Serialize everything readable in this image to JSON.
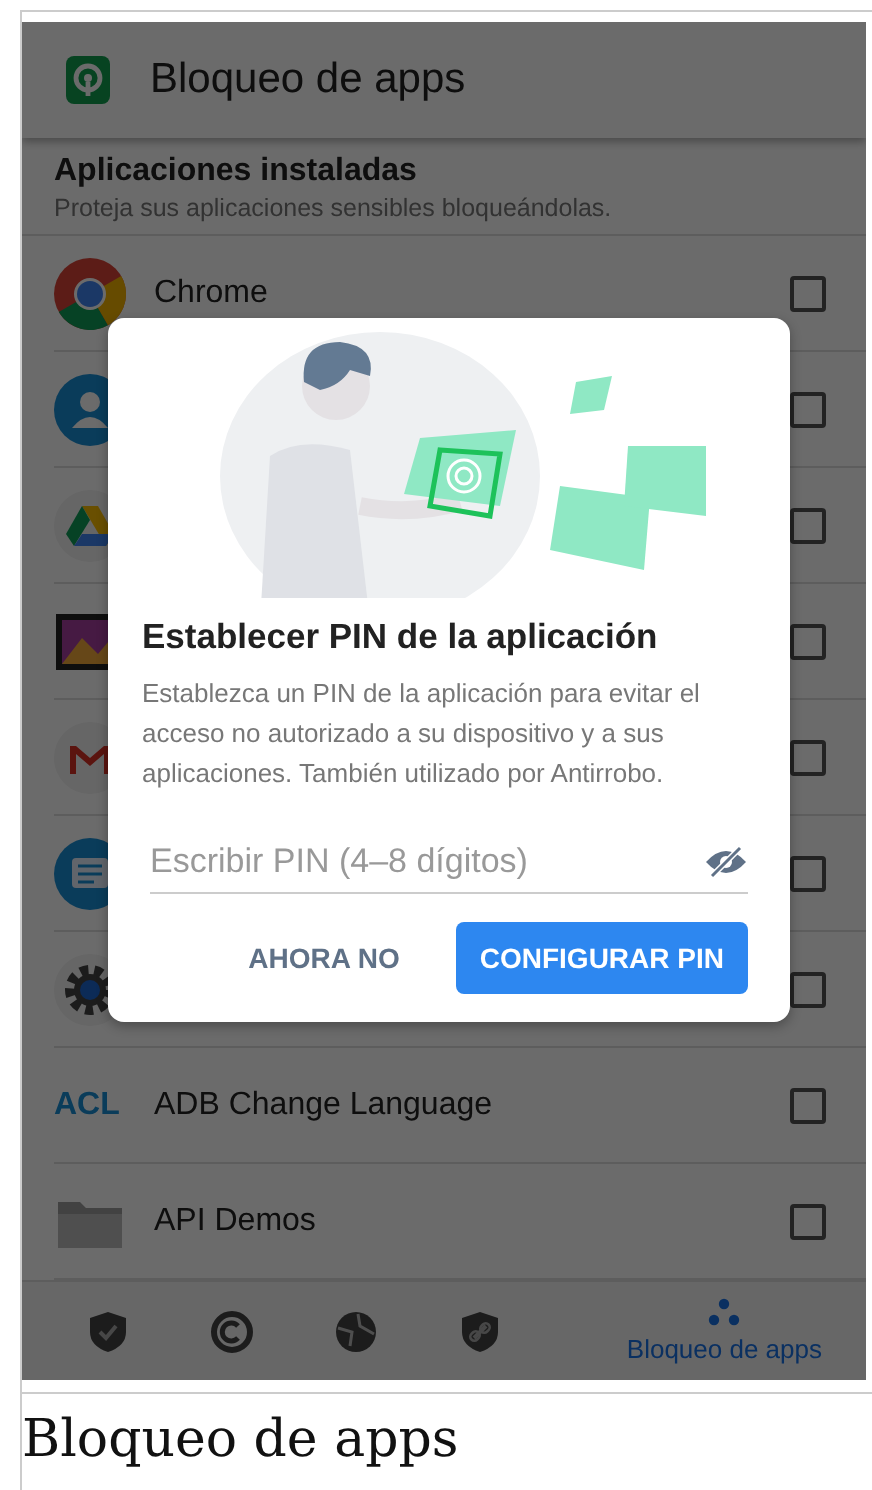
{
  "app_bar": {
    "title": "Bloqueo de apps"
  },
  "section": {
    "title": "Aplicaciones instaladas",
    "subtitle": "Proteja sus aplicaciones sensibles bloqueándolas."
  },
  "apps": [
    {
      "kind": "chrome",
      "name": "Chrome",
      "checked": false
    },
    {
      "kind": "contacts",
      "checked": false
    },
    {
      "kind": "drive",
      "checked": false
    },
    {
      "kind": "gallery",
      "checked": false
    },
    {
      "kind": "gmail",
      "checked": false
    },
    {
      "kind": "messages",
      "checked": false
    },
    {
      "kind": "settings",
      "checked": false
    },
    {
      "kind": "text_logo",
      "logo": "ACL",
      "name": "ADB Change Language",
      "checked": false
    },
    {
      "kind": "folder",
      "name": "API Demos",
      "checked": false
    }
  ],
  "bottom_nav": [
    {
      "kind": "shield_check",
      "selected": false
    },
    {
      "kind": "c_ring",
      "selected": false
    },
    {
      "kind": "globe",
      "selected": false
    },
    {
      "kind": "shield_link",
      "selected": false
    },
    {
      "kind": "dots",
      "label": "Bloqueo de apps",
      "selected": true
    }
  ],
  "dialog": {
    "title": "Establecer PIN de la aplicación",
    "body": "Establezca un PIN de la aplicación para evitar el acceso no autorizado a su dispositivo y a sus aplicaciones. También utilizado por Antirrobo.",
    "pin_field": {
      "placeholder": "Escribir PIN (4–8 dígitos)"
    },
    "buttons": [
      {
        "kind": "text",
        "label": "AHORA NO"
      },
      {
        "kind": "filled",
        "label": "CONFIGURAR PIN"
      }
    ]
  },
  "caption": "Bloqueo de apps"
}
